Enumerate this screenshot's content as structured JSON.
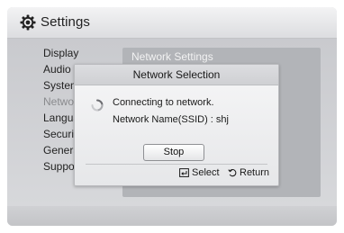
{
  "header": {
    "title": "Settings",
    "icon": "gear-icon"
  },
  "menu": {
    "items": [
      {
        "label": "Display",
        "dim": false
      },
      {
        "label": "Audio",
        "dim": false
      },
      {
        "label": "System",
        "dim": false
      },
      {
        "label": "Network",
        "dim": true
      },
      {
        "label": "Language",
        "dim": false
      },
      {
        "label": "Security",
        "dim": false
      },
      {
        "label": "General",
        "dim": false
      },
      {
        "label": "Support",
        "dim": false
      }
    ]
  },
  "right_panel": {
    "header": "Network Settings"
  },
  "dialog": {
    "title": "Network Selection",
    "status": "Connecting to network.",
    "ssid": "Network Name(SSID) : shj",
    "stop_label": "Stop",
    "select_hint": "Select",
    "return_hint": "Return"
  },
  "colors": {
    "screen_bg": "#d4d5d8",
    "panel_bg": "#b2b4b8",
    "dim_text": "#8a8b8e"
  }
}
